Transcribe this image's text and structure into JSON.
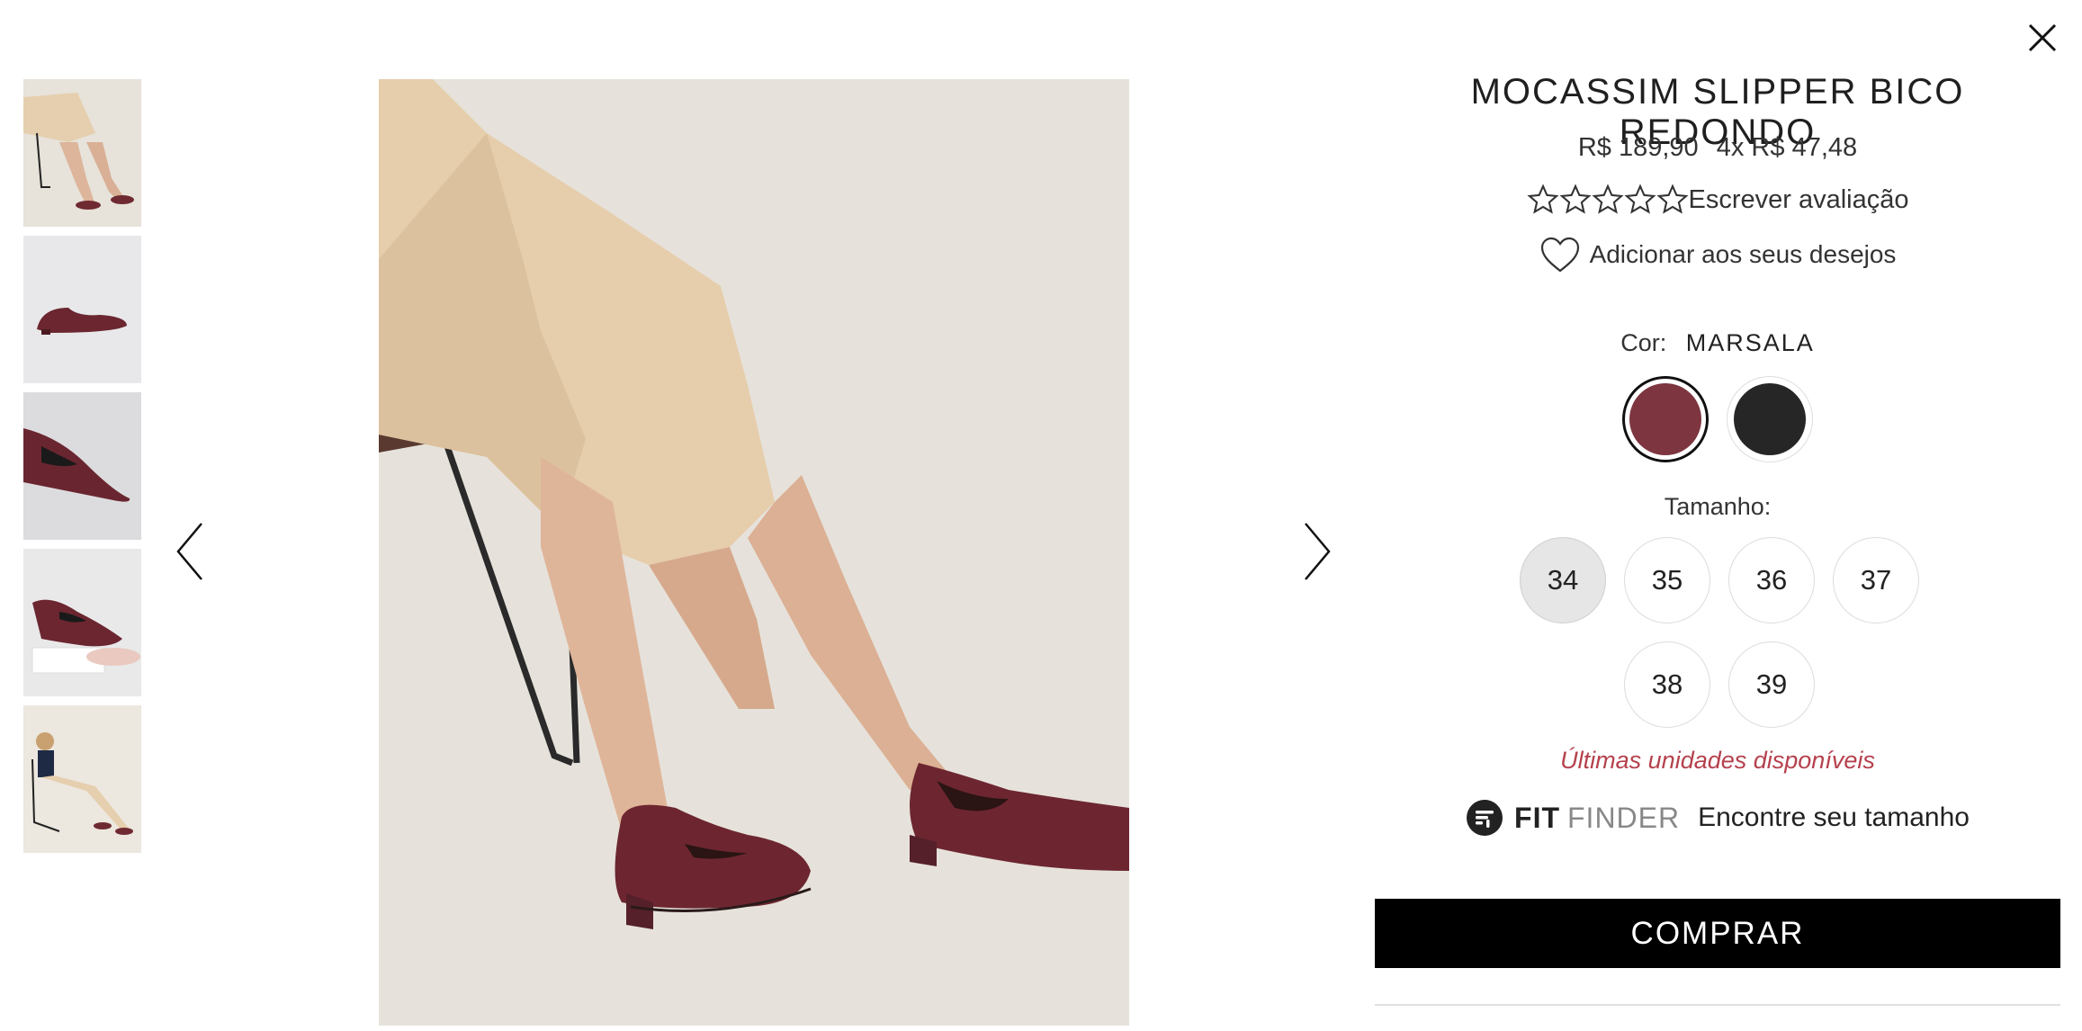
{
  "product": {
    "title": "MOCASSIM SLIPPER BICO REDONDO",
    "price": "R$ 189,90",
    "installments": "4x R$ 47,48",
    "rating_stars": 0,
    "review_link": "Escrever avaliação",
    "wishlist_label": "Adicionar aos seus desejos"
  },
  "color": {
    "label": "Cor:",
    "selected": "MARSALA",
    "options": [
      {
        "hex": "#7d3540",
        "selected": true
      },
      {
        "hex": "#262626",
        "selected": false
      }
    ]
  },
  "size": {
    "label": "Tamanho:",
    "options": [
      "34",
      "35",
      "36",
      "37",
      "38",
      "39"
    ],
    "selected": "34"
  },
  "stock_message": "Últimas unidades disponíveis",
  "fit_finder": {
    "brand_bold": "FIT",
    "brand_light": "FINDER",
    "text": "Encontre seu tamanho"
  },
  "buy_button": "COMPRAR",
  "colors": {
    "accent": "#000000",
    "stock_text": "#b5414d",
    "product_color": "#7d3540"
  },
  "icons": {
    "close": "close-icon",
    "prev": "chevron-left-icon",
    "next": "chevron-right-icon",
    "star": "star-outline-icon",
    "wishlist": "heart-outline-icon"
  }
}
